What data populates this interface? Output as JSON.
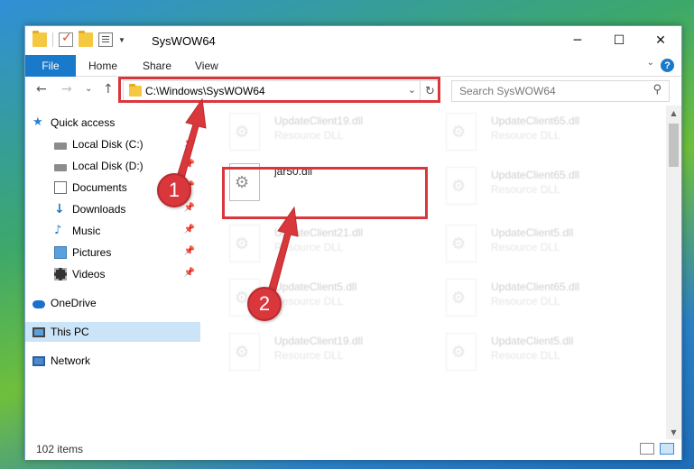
{
  "window": {
    "title": "SysWOW64",
    "controls": {
      "minimize": "─",
      "maximize": "☐",
      "close": "✕"
    }
  },
  "ribbon": {
    "tabs": [
      "File",
      "Home",
      "Share",
      "View"
    ],
    "help": "?",
    "expand": "⌄"
  },
  "nav": {
    "back": "←",
    "forward": "→",
    "recent": "⌄",
    "up": "↑",
    "address": "C:\\Windows\\SysWOW64",
    "address_dropdown": "⌄",
    "refresh": "↻",
    "search_placeholder": "Search SysWOW64"
  },
  "sidebar": {
    "items": [
      {
        "label": "Quick access",
        "icon": "star-icon",
        "pinned": false
      },
      {
        "label": "Local Disk (C:)",
        "icon": "drive-icon",
        "pinned": true
      },
      {
        "label": "Local Disk (D:)",
        "icon": "drive-icon",
        "pinned": true
      },
      {
        "label": "Documents",
        "icon": "documents-icon",
        "pinned": true
      },
      {
        "label": "Downloads",
        "icon": "downloads-icon",
        "pinned": true
      },
      {
        "label": "Music",
        "icon": "music-icon",
        "pinned": true
      },
      {
        "label": "Pictures",
        "icon": "pictures-icon",
        "pinned": true
      },
      {
        "label": "Videos",
        "icon": "videos-icon",
        "pinned": true
      },
      {
        "label": "OneDrive",
        "icon": "onedrive-icon",
        "pinned": false
      },
      {
        "label": "This PC",
        "icon": "this-pc-icon",
        "pinned": false,
        "selected": true
      },
      {
        "label": "Network",
        "icon": "network-icon",
        "pinned": false
      }
    ],
    "pin_glyph": "📌"
  },
  "files": {
    "highlighted": {
      "name": "jar50.dll",
      "type": ""
    },
    "left_column": [
      {
        "name": "UpdateClient19.dll",
        "type": "Resource DLL"
      },
      {
        "name": "UpdateClient21.dll",
        "type": "Resource DLL"
      },
      {
        "name": "UpdateClient5.dll",
        "type": "Resource DLL"
      },
      {
        "name": "UpdateClient19.dll",
        "type": "Resource DLL"
      }
    ],
    "right_column": [
      {
        "name": "UpdateClient65.dll",
        "type": "Resource DLL"
      },
      {
        "name": "UpdateClient65.dll",
        "type": "Resource DLL"
      },
      {
        "name": "UpdateClient5.dll",
        "type": "Resource DLL"
      },
      {
        "name": "UpdateClient65.dll",
        "type": "Resource DLL"
      },
      {
        "name": "UpdateClient5.dll",
        "type": "Resource DLL"
      }
    ]
  },
  "status": {
    "item_count": "102 items"
  },
  "annotations": {
    "step1": "1",
    "step2": "2",
    "color": "#d9373b"
  }
}
